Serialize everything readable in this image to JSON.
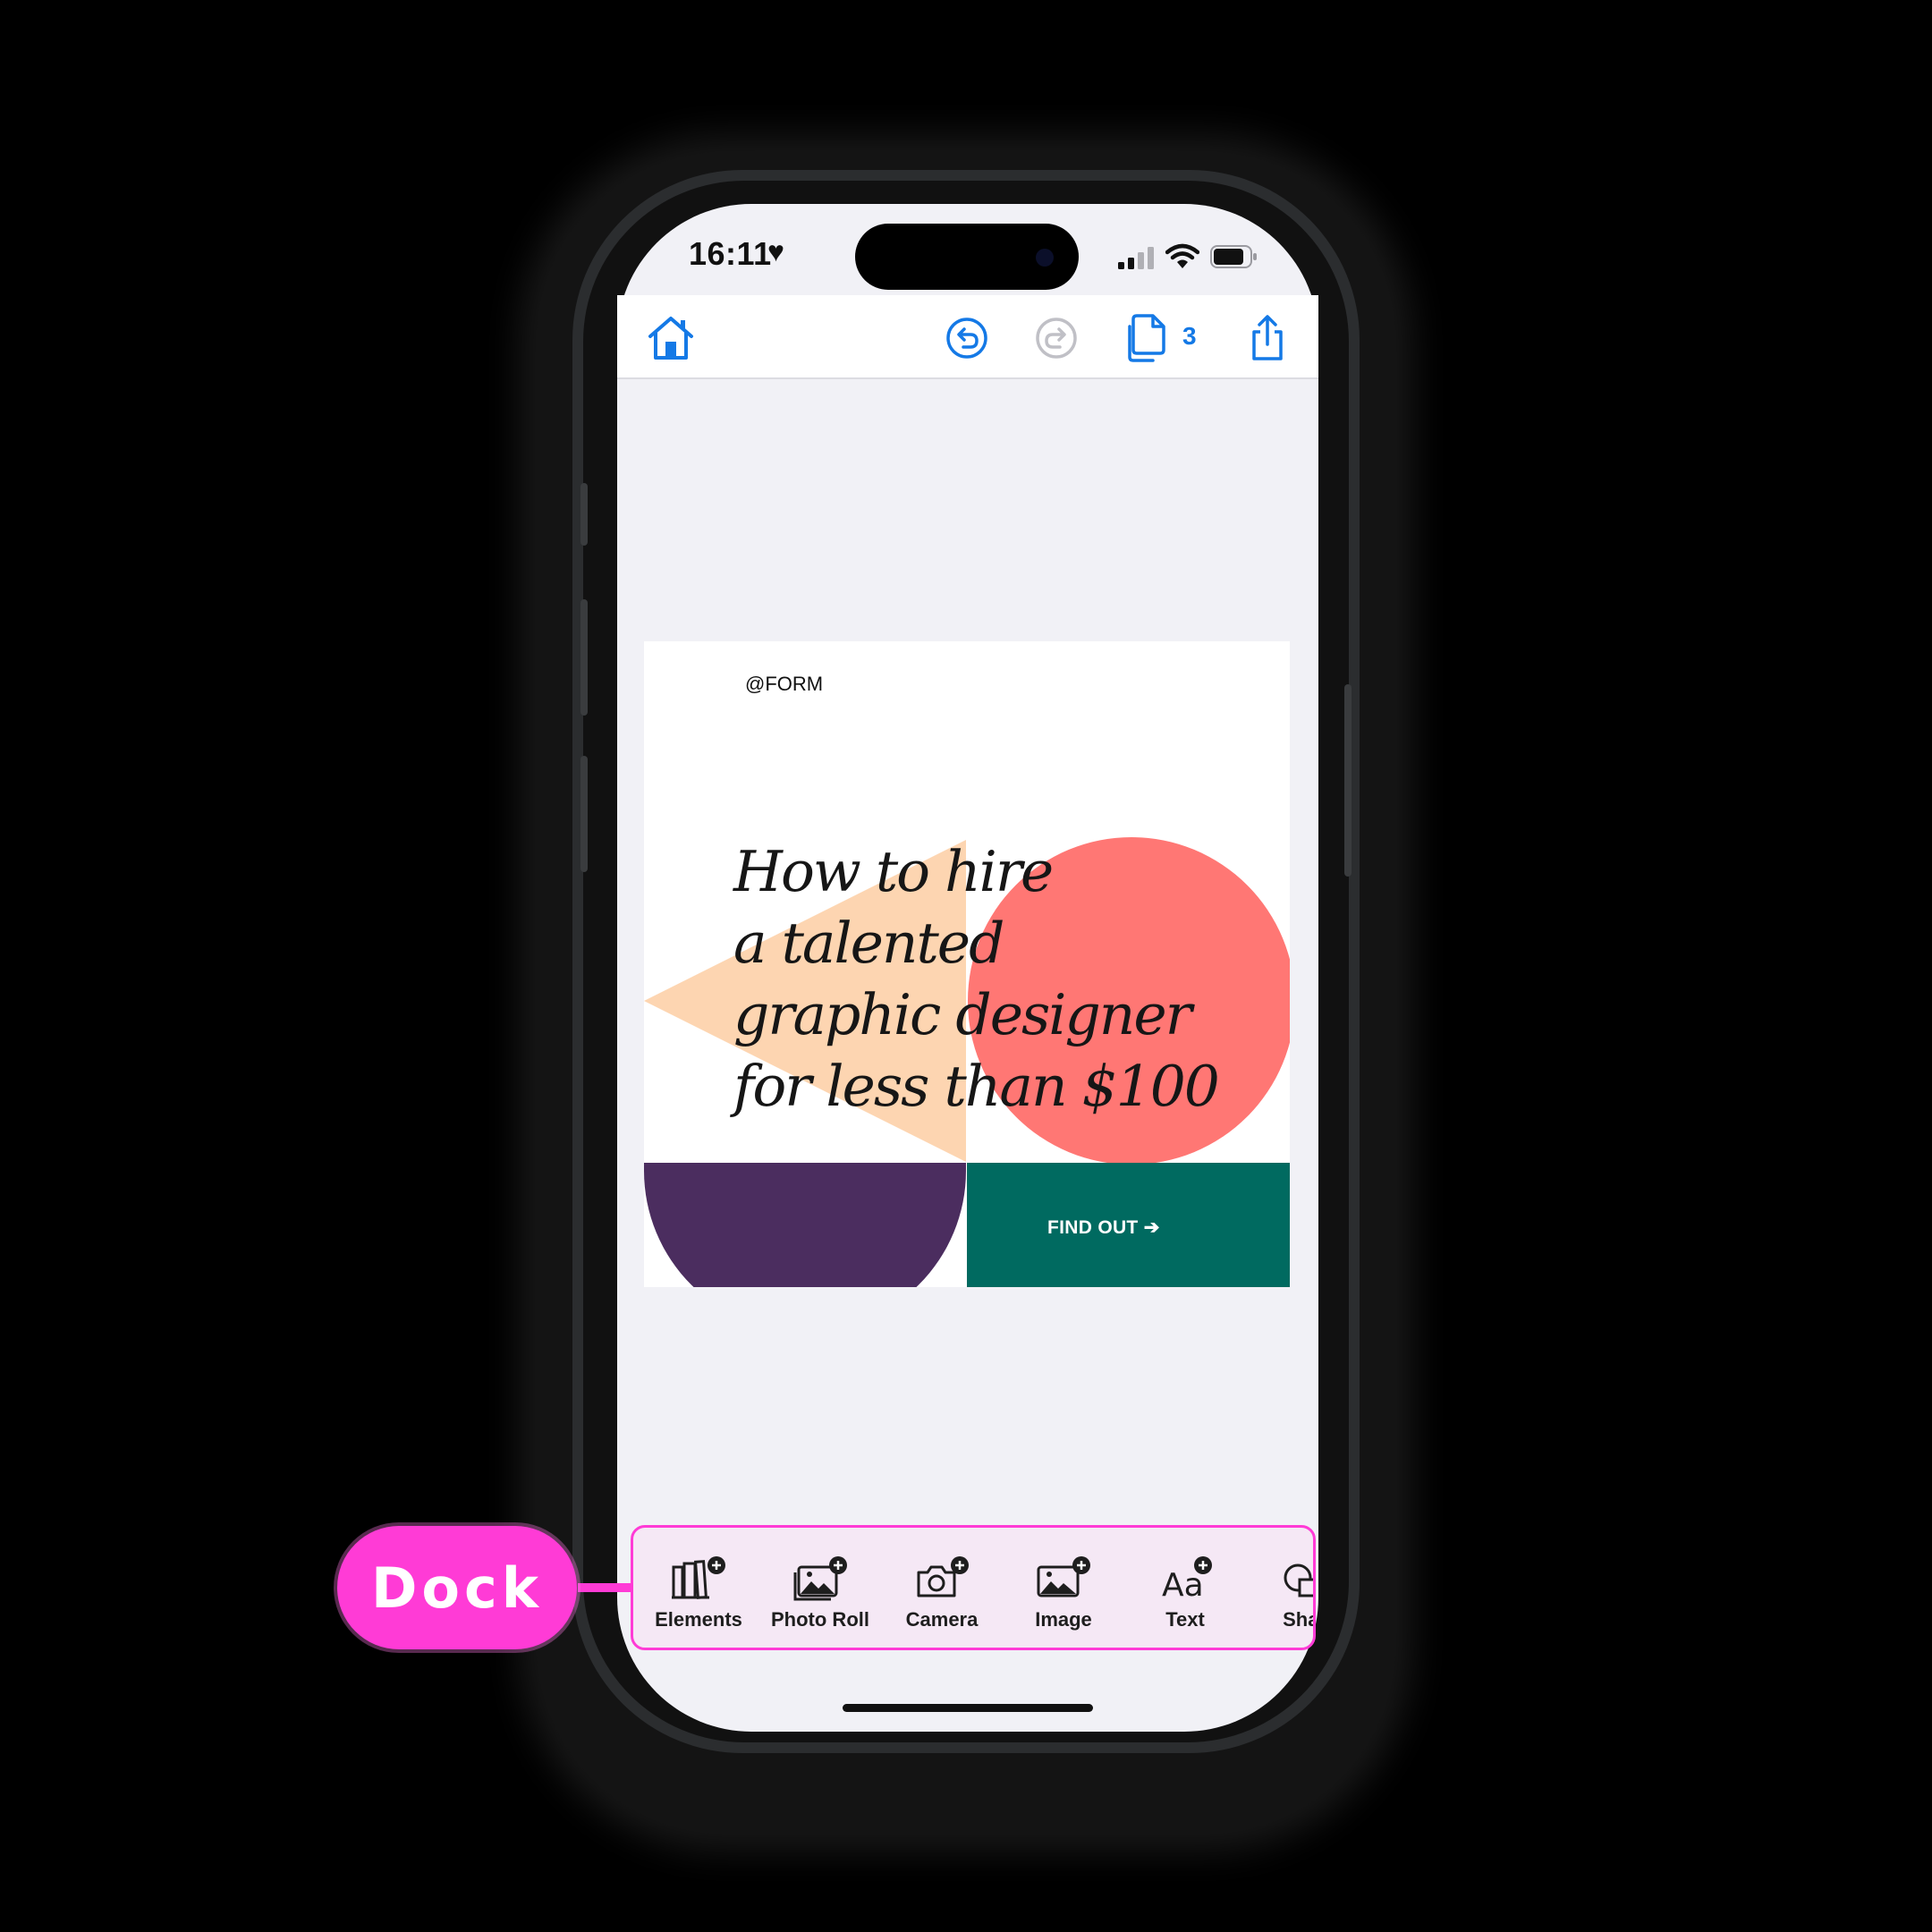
{
  "status_bar": {
    "time": "16:11",
    "heart": "♥"
  },
  "toolbar": {
    "pages_count": "3"
  },
  "design": {
    "handle": "@FORM",
    "headline_lines": [
      "How to hire",
      "a talented",
      "graphic designer",
      "for less than $100"
    ],
    "cta": "FIND OUT ➔",
    "colors": {
      "triangle": "#fdd5b1",
      "circle": "#ff7774",
      "bowl": "#4b2d5f",
      "cta_bg": "#006a60"
    }
  },
  "dock": {
    "items": [
      {
        "label": "Elements",
        "icon": "elements-add-icon"
      },
      {
        "label": "Photo Roll",
        "icon": "photo-roll-add-icon"
      },
      {
        "label": "Camera",
        "icon": "camera-add-icon"
      },
      {
        "label": "Image",
        "icon": "image-add-icon"
      },
      {
        "label": "Text",
        "icon": "text-add-icon"
      },
      {
        "label": "Shap",
        "icon": "shape-add-icon"
      }
    ]
  },
  "annotation": {
    "label": "Dock",
    "color": "#ff3bd6"
  },
  "accent_color": "#1479e6"
}
